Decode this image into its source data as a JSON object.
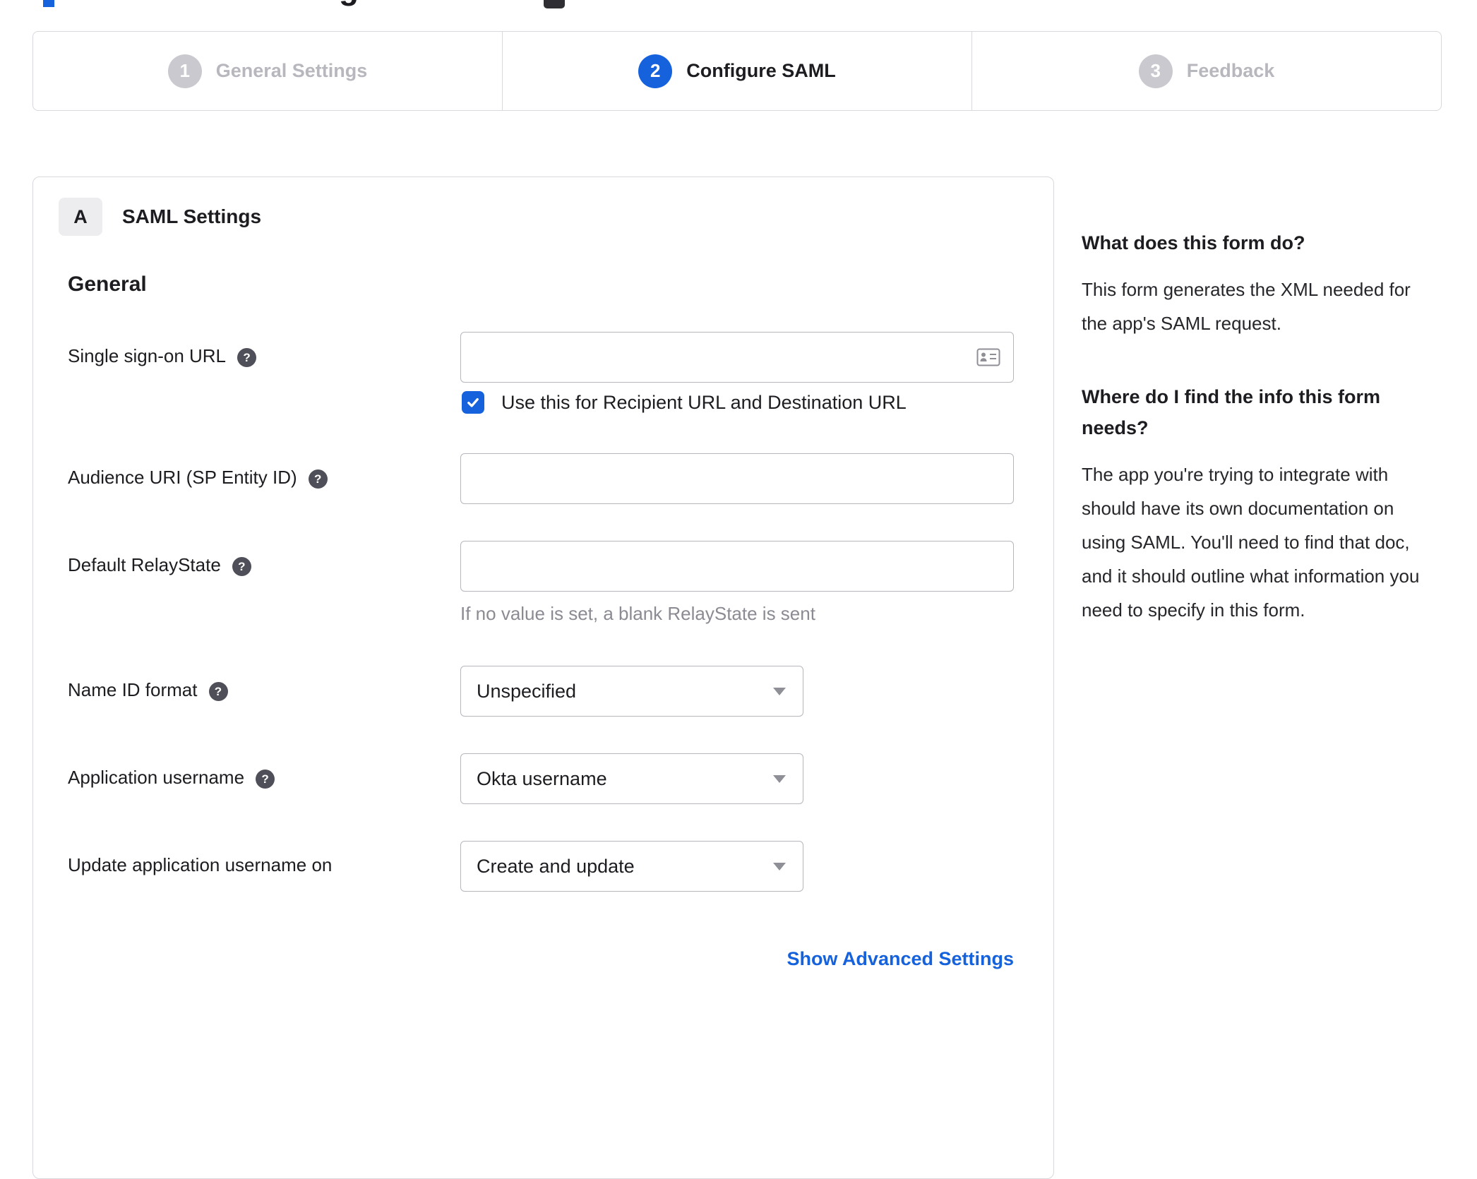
{
  "page": {
    "title": "Create SAML Integration"
  },
  "stepper": {
    "steps": [
      {
        "number": "1",
        "label": "General Settings",
        "state": "inactive"
      },
      {
        "number": "2",
        "label": "Configure SAML",
        "state": "active"
      },
      {
        "number": "3",
        "label": "Feedback",
        "state": "inactive"
      }
    ]
  },
  "form": {
    "section_badge": "A",
    "section_title": "SAML Settings",
    "group_title": "General",
    "fields": {
      "sso_url": {
        "label": "Single sign-on URL",
        "value": ""
      },
      "sso_checkbox": {
        "label": "Use this for Recipient URL and Destination URL",
        "checked": true
      },
      "audience_uri": {
        "label": "Audience URI (SP Entity ID)",
        "value": ""
      },
      "default_relay_state": {
        "label": "Default RelayState",
        "value": "",
        "hint": "If no value is set, a blank RelayState is sent"
      },
      "name_id_format": {
        "label": "Name ID format",
        "value": "Unspecified"
      },
      "application_username": {
        "label": "Application username",
        "value": "Okta username"
      },
      "update_app_username": {
        "label": "Update application username on",
        "value": "Create and update"
      }
    },
    "advanced_link": "Show Advanced Settings"
  },
  "sidebar": {
    "q1": "What does this form do?",
    "a1": "This form generates the XML needed for the app's SAML request.",
    "q2": "Where do I find the info this form needs?",
    "a2": "The app you're trying to integrate with should have its own documentation on using SAML. You'll need to find that doc, and it should outline what information you need to specify in this form."
  },
  "icons": {
    "question": "?"
  },
  "colors": {
    "accent_blue": "#1662dd",
    "inactive_gray": "#c9c9cf",
    "text_dark": "#1d1d21"
  }
}
